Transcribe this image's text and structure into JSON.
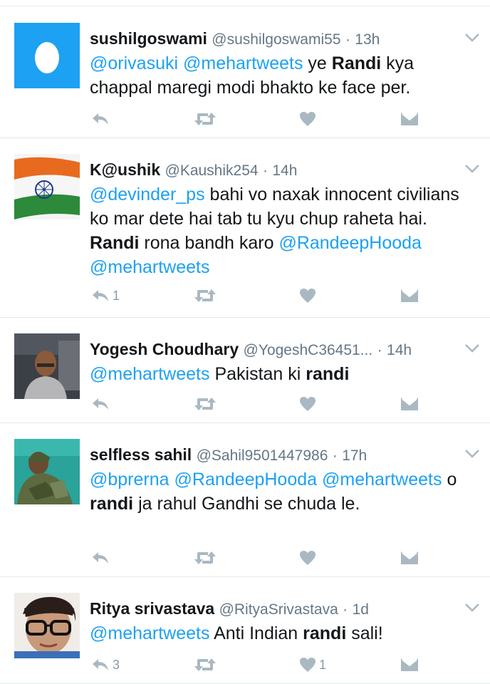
{
  "tweets": [
    {
      "name": "sushilgoswami",
      "handle": "@sushilgoswami55",
      "sep": "·",
      "time": "13h",
      "avatar": "default-egg-avatar",
      "segments": [
        {
          "t": "@orivasuki",
          "k": "m"
        },
        {
          "t": " ",
          "k": "n"
        },
        {
          "t": "@mehartweets",
          "k": "m"
        },
        {
          "t": " ye ",
          "k": "n"
        },
        {
          "t": "Randi",
          "k": "b"
        },
        {
          "t": " kya chappal maregi modi bhakto ke face per.",
          "k": "n"
        }
      ],
      "reply_count": "",
      "like_count": ""
    },
    {
      "name": "K@ushik",
      "handle": "@Kaushik254",
      "sep": "·",
      "time": "14h",
      "avatar": "indian-flag-avatar",
      "segments": [
        {
          "t": "@devinder_ps",
          "k": "m"
        },
        {
          "t": "  bahi vo naxak innocent civilians ko mar dete hai tab tu kyu chup raheta hai. ",
          "k": "n"
        },
        {
          "t": "Randi",
          "k": "b"
        },
        {
          "t": " rona bandh karo ",
          "k": "n"
        },
        {
          "t": "@RandeepHooda",
          "k": "m"
        },
        {
          "t": " ",
          "k": "n"
        },
        {
          "t": "@mehartweets",
          "k": "m"
        }
      ],
      "reply_count": "1",
      "like_count": ""
    },
    {
      "name": "Yogesh Choudhary",
      "handle": "@YogeshC36451...",
      "sep": "·",
      "time": "14h",
      "avatar": "man-photo-avatar",
      "segments": [
        {
          "t": "@mehartweets",
          "k": "m"
        },
        {
          "t": " Pakistan ki ",
          "k": "n"
        },
        {
          "t": "randi",
          "k": "b"
        }
      ],
      "reply_count": "",
      "like_count": ""
    },
    {
      "name": "selfless sahil",
      "handle": "@Sahil9501447986",
      "sep": "·",
      "time": "17h",
      "avatar": "soldier-photo-avatar",
      "segments": [
        {
          "t": "@bprerna",
          "k": "m"
        },
        {
          "t": " ",
          "k": "n"
        },
        {
          "t": "@RandeepHooda",
          "k": "m"
        },
        {
          "t": " ",
          "k": "n"
        },
        {
          "t": "@mehartweets",
          "k": "m"
        },
        {
          "t": " o ",
          "k": "n"
        },
        {
          "t": "randi",
          "k": "b"
        },
        {
          "t": " ja rahul Gandhi se chuda le.",
          "k": "n"
        }
      ],
      "reply_count": "",
      "like_count": ""
    },
    {
      "name": "Ritya srivastava",
      "handle": "@RityaSrivastava",
      "sep": "·",
      "time": "1d",
      "avatar": "woman-glasses-avatar",
      "segments": [
        {
          "t": "@mehartweets",
          "k": "m"
        },
        {
          "t": " Anti Indian ",
          "k": "n"
        },
        {
          "t": "randi",
          "k": "b"
        },
        {
          "t": " sali!",
          "k": "n"
        }
      ],
      "reply_count": "3",
      "like_count": "1"
    }
  ],
  "icons": {
    "reply": "reply-icon",
    "retweet": "retweet-icon",
    "like": "heart-icon",
    "dm": "direct-message-icon",
    "more": "chevron-down-icon"
  },
  "colors": {
    "mention": "#1da1f2",
    "icon": "#aab8c2",
    "handle": "#657786",
    "egg_bg": "#1da1f2"
  }
}
